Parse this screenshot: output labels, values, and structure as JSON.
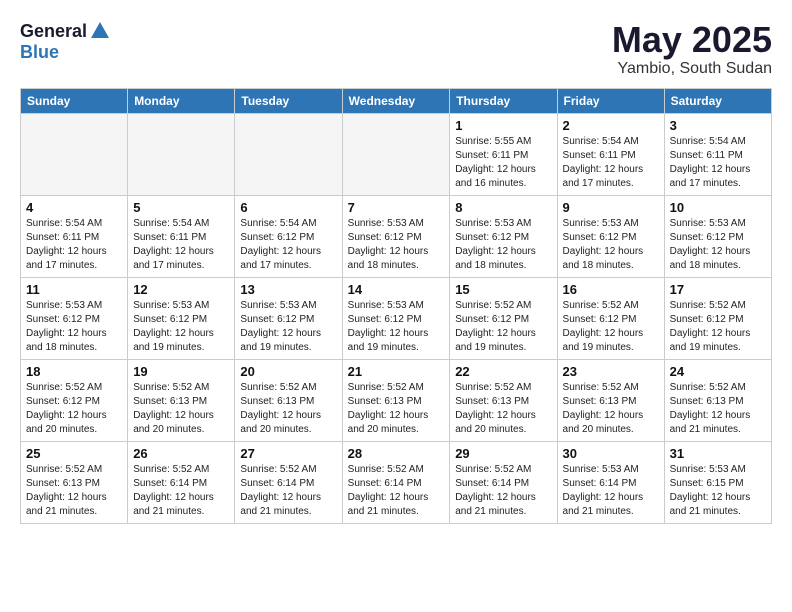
{
  "header": {
    "logo_general": "General",
    "logo_blue": "Blue",
    "month": "May 2025",
    "location": "Yambio, South Sudan"
  },
  "weekdays": [
    "Sunday",
    "Monday",
    "Tuesday",
    "Wednesday",
    "Thursday",
    "Friday",
    "Saturday"
  ],
  "weeks": [
    [
      {
        "day": "",
        "info": ""
      },
      {
        "day": "",
        "info": ""
      },
      {
        "day": "",
        "info": ""
      },
      {
        "day": "",
        "info": ""
      },
      {
        "day": "1",
        "info": "Sunrise: 5:55 AM\nSunset: 6:11 PM\nDaylight: 12 hours\nand 16 minutes."
      },
      {
        "day": "2",
        "info": "Sunrise: 5:54 AM\nSunset: 6:11 PM\nDaylight: 12 hours\nand 17 minutes."
      },
      {
        "day": "3",
        "info": "Sunrise: 5:54 AM\nSunset: 6:11 PM\nDaylight: 12 hours\nand 17 minutes."
      }
    ],
    [
      {
        "day": "4",
        "info": "Sunrise: 5:54 AM\nSunset: 6:11 PM\nDaylight: 12 hours\nand 17 minutes."
      },
      {
        "day": "5",
        "info": "Sunrise: 5:54 AM\nSunset: 6:11 PM\nDaylight: 12 hours\nand 17 minutes."
      },
      {
        "day": "6",
        "info": "Sunrise: 5:54 AM\nSunset: 6:12 PM\nDaylight: 12 hours\nand 17 minutes."
      },
      {
        "day": "7",
        "info": "Sunrise: 5:53 AM\nSunset: 6:12 PM\nDaylight: 12 hours\nand 18 minutes."
      },
      {
        "day": "8",
        "info": "Sunrise: 5:53 AM\nSunset: 6:12 PM\nDaylight: 12 hours\nand 18 minutes."
      },
      {
        "day": "9",
        "info": "Sunrise: 5:53 AM\nSunset: 6:12 PM\nDaylight: 12 hours\nand 18 minutes."
      },
      {
        "day": "10",
        "info": "Sunrise: 5:53 AM\nSunset: 6:12 PM\nDaylight: 12 hours\nand 18 minutes."
      }
    ],
    [
      {
        "day": "11",
        "info": "Sunrise: 5:53 AM\nSunset: 6:12 PM\nDaylight: 12 hours\nand 18 minutes."
      },
      {
        "day": "12",
        "info": "Sunrise: 5:53 AM\nSunset: 6:12 PM\nDaylight: 12 hours\nand 19 minutes."
      },
      {
        "day": "13",
        "info": "Sunrise: 5:53 AM\nSunset: 6:12 PM\nDaylight: 12 hours\nand 19 minutes."
      },
      {
        "day": "14",
        "info": "Sunrise: 5:53 AM\nSunset: 6:12 PM\nDaylight: 12 hours\nand 19 minutes."
      },
      {
        "day": "15",
        "info": "Sunrise: 5:52 AM\nSunset: 6:12 PM\nDaylight: 12 hours\nand 19 minutes."
      },
      {
        "day": "16",
        "info": "Sunrise: 5:52 AM\nSunset: 6:12 PM\nDaylight: 12 hours\nand 19 minutes."
      },
      {
        "day": "17",
        "info": "Sunrise: 5:52 AM\nSunset: 6:12 PM\nDaylight: 12 hours\nand 19 minutes."
      }
    ],
    [
      {
        "day": "18",
        "info": "Sunrise: 5:52 AM\nSunset: 6:12 PM\nDaylight: 12 hours\nand 20 minutes."
      },
      {
        "day": "19",
        "info": "Sunrise: 5:52 AM\nSunset: 6:13 PM\nDaylight: 12 hours\nand 20 minutes."
      },
      {
        "day": "20",
        "info": "Sunrise: 5:52 AM\nSunset: 6:13 PM\nDaylight: 12 hours\nand 20 minutes."
      },
      {
        "day": "21",
        "info": "Sunrise: 5:52 AM\nSunset: 6:13 PM\nDaylight: 12 hours\nand 20 minutes."
      },
      {
        "day": "22",
        "info": "Sunrise: 5:52 AM\nSunset: 6:13 PM\nDaylight: 12 hours\nand 20 minutes."
      },
      {
        "day": "23",
        "info": "Sunrise: 5:52 AM\nSunset: 6:13 PM\nDaylight: 12 hours\nand 20 minutes."
      },
      {
        "day": "24",
        "info": "Sunrise: 5:52 AM\nSunset: 6:13 PM\nDaylight: 12 hours\nand 21 minutes."
      }
    ],
    [
      {
        "day": "25",
        "info": "Sunrise: 5:52 AM\nSunset: 6:13 PM\nDaylight: 12 hours\nand 21 minutes."
      },
      {
        "day": "26",
        "info": "Sunrise: 5:52 AM\nSunset: 6:14 PM\nDaylight: 12 hours\nand 21 minutes."
      },
      {
        "day": "27",
        "info": "Sunrise: 5:52 AM\nSunset: 6:14 PM\nDaylight: 12 hours\nand 21 minutes."
      },
      {
        "day": "28",
        "info": "Sunrise: 5:52 AM\nSunset: 6:14 PM\nDaylight: 12 hours\nand 21 minutes."
      },
      {
        "day": "29",
        "info": "Sunrise: 5:52 AM\nSunset: 6:14 PM\nDaylight: 12 hours\nand 21 minutes."
      },
      {
        "day": "30",
        "info": "Sunrise: 5:53 AM\nSunset: 6:14 PM\nDaylight: 12 hours\nand 21 minutes."
      },
      {
        "day": "31",
        "info": "Sunrise: 5:53 AM\nSunset: 6:15 PM\nDaylight: 12 hours\nand 21 minutes."
      }
    ]
  ]
}
